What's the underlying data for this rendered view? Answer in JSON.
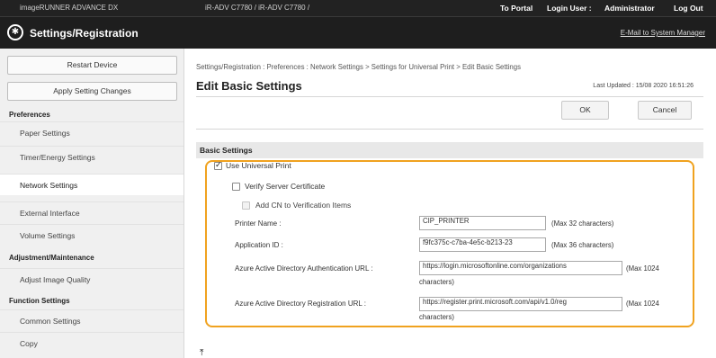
{
  "topbar": {
    "device_name": "imageRUNNER ADVANCE DX",
    "device_model": "iR-ADV C7780 / iR-ADV C7780 /",
    "to_portal": "To Portal",
    "login_label": "Login User :",
    "login_user": "Administrator",
    "logout": "Log Out"
  },
  "header": {
    "title": "Settings/Registration",
    "email_link": "E-Mail to System Manager"
  },
  "sidebar": {
    "restart_button": "Restart Device",
    "apply_button": "Apply Setting Changes",
    "sections": [
      {
        "header": "Preferences",
        "items": [
          "Paper Settings",
          "Timer/Energy Settings",
          "Network Settings",
          "External Interface",
          "Volume Settings"
        ]
      },
      {
        "header": "Adjustment/Maintenance",
        "items": [
          "Adjust Image Quality"
        ]
      },
      {
        "header": "Function Settings",
        "items": [
          "Common Settings",
          "Copy"
        ]
      }
    ],
    "active_item": "Network Settings"
  },
  "main": {
    "breadcrumb": "Settings/Registration : Preferences : Network Settings > Settings for Universal Print > Edit Basic Settings",
    "page_title": "Edit Basic Settings",
    "last_updated": "Last Updated : 15/08 2020 16:51:26",
    "ok_button": "OK",
    "cancel_button": "Cancel",
    "section_title": "Basic Settings",
    "use_universal_print": {
      "label": "Use Universal Print",
      "checked": true
    },
    "verify_server_cert": {
      "label": "Verify Server Certificate",
      "checked": false
    },
    "add_cn": {
      "label": "Add CN to Verification Items",
      "checked": false
    },
    "printer_name": {
      "label": "Printer Name :",
      "value": "CIP_PRINTER",
      "note": "(Max 32 characters)"
    },
    "application_id": {
      "label": "Application ID :",
      "value": "f9fc375c-c7ba-4e5c-b213-23",
      "note": "(Max 36 characters)"
    },
    "azure_auth_url": {
      "label": "Azure Active Directory Authentication URL :",
      "value": "https://login.microsoftonline.com/organizations",
      "note": "(Max 1024",
      "note2": "characters)"
    },
    "azure_reg_url": {
      "label": "Azure Active Directory Registration URL :",
      "value": "https://register.print.microsoft.com/api/v1.0/reg",
      "note": "(Max 1024",
      "note2": "characters)"
    }
  }
}
